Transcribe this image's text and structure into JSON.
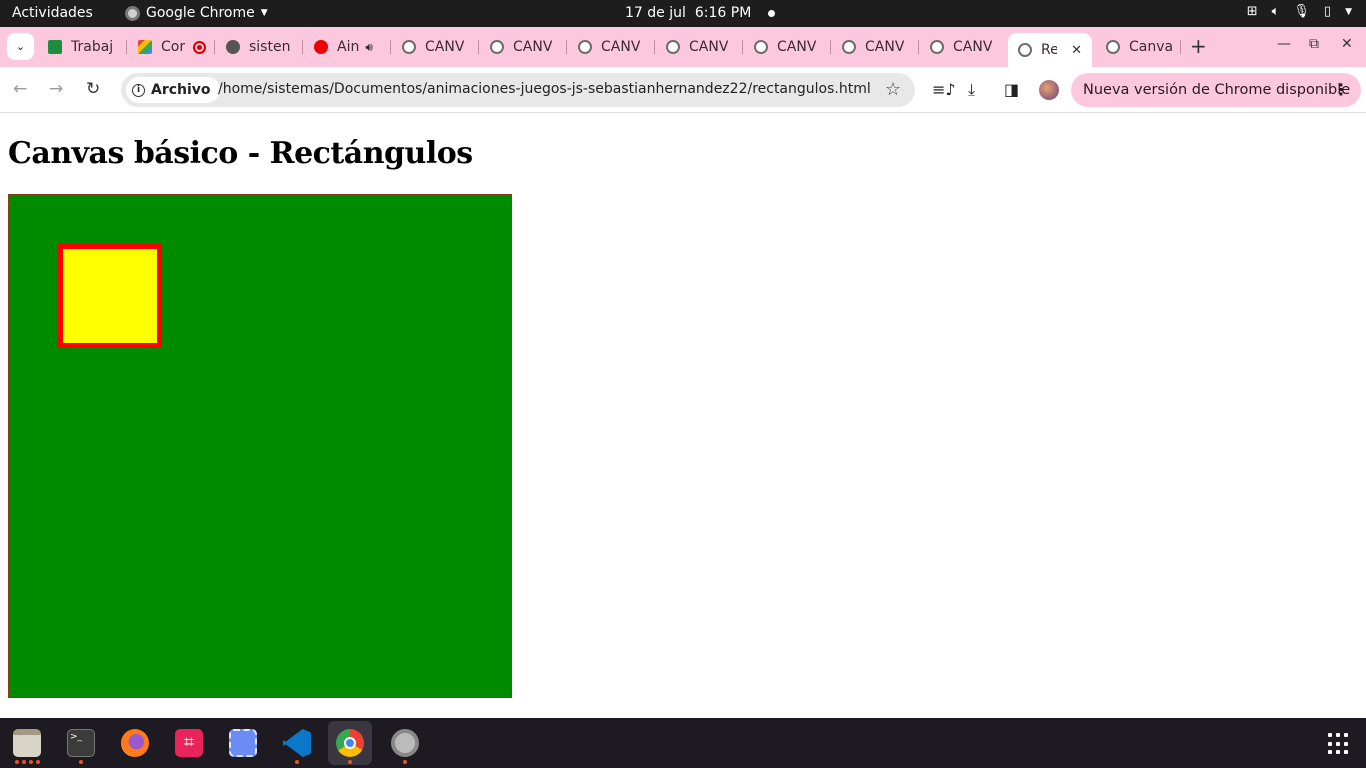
{
  "topbar": {
    "activities": "Actividades",
    "app_name": "Google Chrome",
    "date": "17 de jul",
    "time": "6:16 PM"
  },
  "tabs": [
    {
      "label": "Trabaj",
      "icon": "sheets-icon"
    },
    {
      "label": "Cor",
      "icon": "meet-icon",
      "recording": true
    },
    {
      "label": "sisten",
      "icon": "github-icon"
    },
    {
      "label": "Ain",
      "icon": "youtube-icon",
      "audio": true
    },
    {
      "label": "CANV",
      "icon": "globe-icon"
    },
    {
      "label": "CANV",
      "icon": "globe-icon"
    },
    {
      "label": "CANV",
      "icon": "globe-icon"
    },
    {
      "label": "CANV",
      "icon": "globe-icon"
    },
    {
      "label": "CANV",
      "icon": "globe-icon"
    },
    {
      "label": "CANV",
      "icon": "globe-icon"
    },
    {
      "label": "CANV",
      "icon": "globe-icon"
    },
    {
      "label": "Re",
      "icon": "globe-icon",
      "active": true
    },
    {
      "label": "Canva",
      "icon": "globe-icon"
    }
  ],
  "toolbar": {
    "file_chip": "Archivo",
    "url": "/home/sistemas/Documentos/animaciones-juegos-js-sebastianhernandez22/rectangulos.html",
    "update_label": "Nueva versión de Chrome disponible"
  },
  "page": {
    "heading": "Canvas básico - Rectángulos"
  },
  "colors": {
    "canvas_fill": "#008a00",
    "square_fill": "#ffff00",
    "square_stroke": "#ff0000",
    "tabstrip": "#fcc8dd"
  },
  "dock": [
    {
      "name": "files"
    },
    {
      "name": "terminal"
    },
    {
      "name": "firefox"
    },
    {
      "name": "screenshot-tool"
    },
    {
      "name": "screen-recorder"
    },
    {
      "name": "vscode"
    },
    {
      "name": "chrome"
    },
    {
      "name": "settings"
    }
  ]
}
